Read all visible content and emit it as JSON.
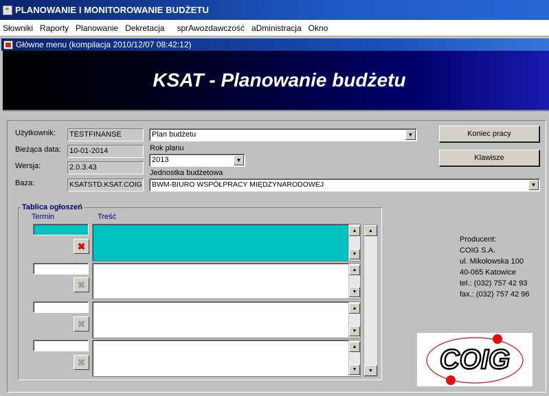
{
  "window": {
    "title": "PLANOWANIE I MONITOROWANIE BUDŻETU"
  },
  "menu": [
    "Słowniki",
    "Raporty",
    "Planowanie",
    "Dekretacja",
    "sprAwozdawczość",
    "aDministracja",
    "Okno"
  ],
  "inner_window": {
    "title": "Główne menu (kompilacja 2010/12/07 08:42:12)"
  },
  "banner": {
    "title": "KSAT - Planowanie budżetu"
  },
  "fields": {
    "user_label": "Użytkownik:",
    "user_value": "TESTFINANSE",
    "date_label": "Bieżąca data:",
    "date_value": "10-01-2014",
    "version_label": "Wersja:",
    "version_value": "2.0.3.43",
    "db_label": "Baza:",
    "db_value": "KSATSTD.KSAT.COIG",
    "plan_value": "Plan budżetu",
    "year_label": "Rok planu",
    "year_value": "2013",
    "unit_label": "Jednostka budżetowa",
    "unit_value": "BWM-BIURO WSPÓŁPRACY MIĘDZYNARODOWEJ"
  },
  "buttons": {
    "exit": "Koniec pracy",
    "keys": "Klawisze"
  },
  "notice_board": {
    "title": "Tablica ogłoszeń",
    "col_term": "Termin",
    "col_content": "Treść",
    "rows": [
      {
        "term": "",
        "content": "",
        "active": true
      },
      {
        "term": "",
        "content": "",
        "active": false
      },
      {
        "term": "",
        "content": "",
        "active": false
      },
      {
        "term": "",
        "content": "",
        "active": false
      }
    ]
  },
  "producer": {
    "lines": [
      "Producent:",
      "COIG S.A.",
      "ul. Mikołowska 100",
      "40-065 Katowice",
      "tel.: (032) 757 42 93",
      "fax.: (032) 757 42 96"
    ]
  },
  "logo_text": "COIG",
  "colors": {
    "accent_active_row": "#00c0c0",
    "title_blue": "#0a246a"
  },
  "icons": {
    "app": "java-cup-icon",
    "delete": "delete-x-icon",
    "scroll_up": "arrow-up-icon",
    "scroll_down": "arrow-down-icon",
    "dropdown": "chevron-down-icon"
  }
}
